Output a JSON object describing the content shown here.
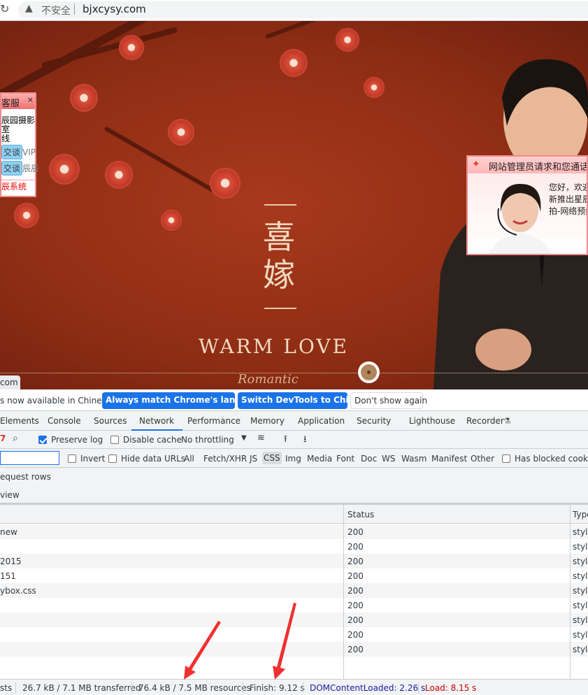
{
  "address_bar": {
    "warning_icon": "warning-triangle-icon",
    "security_label": "不安全",
    "url": "bjxcysy.com"
  },
  "banner": {
    "title_chars": [
      "喜",
      "嫁"
    ],
    "subtitle": "WARM LOVE",
    "script_text": "Romantic",
    "tab_fragment": "com",
    "colors": {
      "background": "#8e2d14",
      "text": "#f0d9c0"
    }
  },
  "kefu_widget": {
    "title": "客服",
    "close": "×",
    "lines": [
      "辰园摄影",
      "室",
      "线"
    ],
    "buttons": [
      "交谈",
      "交谈"
    ],
    "side_texts": [
      "VIP",
      "辰辰"
    ],
    "footer": "辰系统"
  },
  "call_popup": {
    "title": "网站管理员请求和您通话（",
    "lines": [
      "您好，欢迎",
      "新推出星辰",
      "拍-网络预约"
    ]
  },
  "infobar": {
    "message": "s now available in Chinese!",
    "buttons": [
      "Always match Chrome's language",
      "Switch DevTools to Chinese"
    ],
    "dismiss": "Don't show again"
  },
  "devtools": {
    "tabs": [
      "Elements",
      "Console",
      "Sources",
      "Network",
      "Performance",
      "Memory",
      "Application",
      "Security",
      "Lighthouse",
      "Recorder"
    ],
    "active_tab": "Network",
    "toolbar": {
      "preserve_log": "Preserve log",
      "preserve_log_checked": true,
      "disable_cache": "Disable cache",
      "disable_cache_checked": false,
      "throttling": "No throttling"
    },
    "filter": {
      "value": "",
      "invert": "Invert",
      "hide_data_urls": "Hide data URLs",
      "types": [
        "All",
        "Fetch/XHR",
        "JS",
        "CSS",
        "Img",
        "Media",
        "Font",
        "Doc",
        "WS",
        "Wasm",
        "Manifest",
        "Other"
      ],
      "active_type": "CSS",
      "blocked": "Has blocked cookies"
    },
    "options": [
      "equest rows",
      "view"
    ],
    "table": {
      "columns": [
        "",
        "Status",
        "Type"
      ],
      "rows": [
        [
          "new",
          "200",
          "style"
        ],
        [
          "",
          "200",
          "style"
        ],
        [
          "2015",
          "200",
          "style"
        ],
        [
          "151",
          "200",
          "style"
        ],
        [
          "ybox.css",
          "200",
          "style"
        ],
        [
          "",
          "200",
          "style"
        ],
        [
          "",
          "200",
          "style"
        ],
        [
          "",
          "200",
          "style"
        ],
        [
          "",
          "200",
          "style"
        ]
      ]
    },
    "footer": {
      "requests": "sts",
      "transferred": "26.7 kB / 7.1 MB transferred",
      "resources": "76.4 kB / 7.5 MB resources",
      "finish": "Finish: 9.12 s",
      "dom": "DOMContentLoaded: 2.26 s",
      "load": "Load: 8.15 s",
      "dom_color": "#1a1aa6",
      "load_color": "#c80000"
    }
  }
}
